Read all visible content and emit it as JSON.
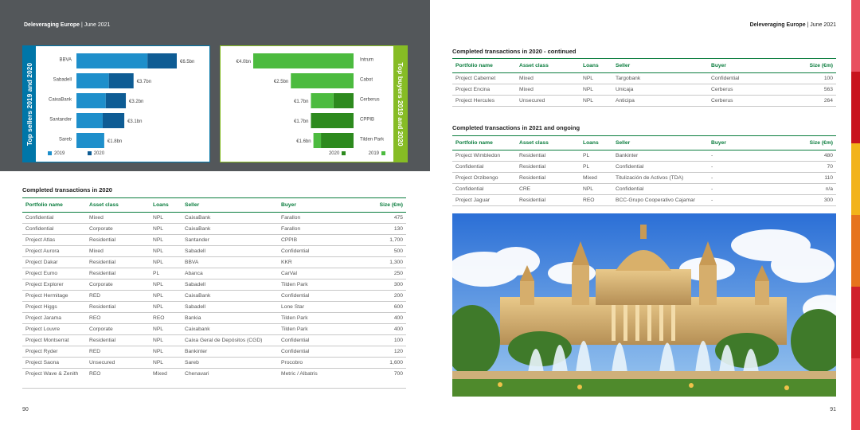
{
  "colors": {
    "blue_dark": "#0e5c94",
    "blue_light": "#1e8fcb",
    "green_dark": "#2d8a1e",
    "green_light": "#4cbb3f",
    "table_accent": "#0b7d3e"
  },
  "left_page": {
    "header_bold": "Deleveraging Europe",
    "header_rest": " | June 2021",
    "page_number": "90",
    "sellers_chart": {
      "side_title": "Top sellers 2019 and 2020",
      "legend": [
        "2019",
        "2020"
      ]
    },
    "buyers_chart": {
      "side_title": "Top buyers 2019 and 2020",
      "legend": [
        "2020",
        "2019"
      ]
    },
    "table_title": "Completed transactions in 2020",
    "table": {
      "headers": [
        "Portfolio name",
        "Asset class",
        "Loans",
        "Seller",
        "Buyer",
        "Size (€m)"
      ],
      "rows": [
        [
          "Confidential",
          "Mixed",
          "NPL",
          "CaixaBank",
          "Farallon",
          "475"
        ],
        [
          "Confidential",
          "Corporate",
          "NPL",
          "CaixaBank",
          "Farallon",
          "130"
        ],
        [
          "Project Atlas",
          "Residential",
          "NPL",
          "Santander",
          "CPPIB",
          "1,700"
        ],
        [
          "Project Aurora",
          "Mixed",
          "NPL",
          "Sabadell",
          "Confidential",
          "500"
        ],
        [
          "Project Dakar",
          "Residential",
          "NPL",
          "BBVA",
          "KKR",
          "1,300"
        ],
        [
          "Project Eumo",
          "Residential",
          "PL",
          "Abanca",
          "CarVal",
          "250"
        ],
        [
          "Project Explorer",
          "Corporate",
          "NPL",
          "Sabadell",
          "Tilden Park",
          "300"
        ],
        [
          "Project Hermitage",
          "RED",
          "NPL",
          "CaixaBank",
          "Confidential",
          "200"
        ],
        [
          "Project Higgs",
          "Residential",
          "NPL",
          "Sabadell",
          "Lone Star",
          "600"
        ],
        [
          "Project Jarama",
          "REO",
          "REO",
          "Bankia",
          "Tilden Park",
          "400"
        ],
        [
          "Project Louvre",
          "Corporate",
          "NPL",
          "Caixabank",
          "Tilden Park",
          "400"
        ],
        [
          "Project Montserrat",
          "Residential",
          "NPL",
          "Caixa Geral de Depósitos (CGD)",
          "Confidential",
          "100"
        ],
        [
          "Project Ryder",
          "RED",
          "NPL",
          "Bankinter",
          "Confidential",
          "120"
        ],
        [
          "Project Saona",
          "Unsecured",
          "NPL",
          "Sareb",
          "Procobro",
          "1,600"
        ],
        [
          "Project Wave & Zenith",
          "REO",
          "Mixed",
          "Chenavari",
          "Metric / Albatris",
          "700"
        ]
      ]
    }
  },
  "right_page": {
    "header_bold": "Deleveraging Europe",
    "header_rest": " | June 2021",
    "page_number": "91",
    "table1_title": "Completed transactions in 2020 - continued",
    "table1": {
      "headers": [
        "Portfolio name",
        "Asset class",
        "Loans",
        "Seller",
        "Buyer",
        "Size (€m)"
      ],
      "rows": [
        [
          "Project Cabernet",
          "Mixed",
          "NPL",
          "Targobank",
          "Confidential",
          "100"
        ],
        [
          "Project Encina",
          "Mixed",
          "NPL",
          "Unicaja",
          "Cerberus",
          "563"
        ],
        [
          "Project Hercules",
          "Unsecured",
          "NPL",
          "Anticipa",
          "Cerberus",
          "264"
        ]
      ]
    },
    "table2_title": "Completed transactions in 2021 and ongoing",
    "table2": {
      "headers": [
        "Portfolio name",
        "Asset class",
        "Loans",
        "Seller",
        "Buyer",
        "Size (€m)"
      ],
      "rows": [
        [
          "Project Wimbledon",
          "Residential",
          "PL",
          "Bankinter",
          "-",
          "480"
        ],
        [
          "Confidential",
          "Residential",
          "PL",
          "Confidential",
          "-",
          "70"
        ],
        [
          "Project Orzibengo",
          "Residential",
          "Mixed",
          "Titulización de Activos (TDA)",
          "-",
          "110"
        ],
        [
          "Confidential",
          "CRE",
          "NPL",
          "Confidential",
          "-",
          "n/a"
        ],
        [
          "Project Jaguar",
          "Residential",
          "REO",
          "BCC-Grupo Cooperativo Cajamar",
          "-",
          "300"
        ]
      ]
    },
    "photo_icon": "palace-fountain-photo"
  },
  "chart_data": [
    {
      "type": "bar",
      "orientation": "horizontal",
      "stacked": true,
      "title": "Top sellers 2019 and 2020",
      "categories": [
        "BBVA",
        "Sabadell",
        "CaixaBank",
        "Santander",
        "Sareb"
      ],
      "totals_labels": [
        "€6.5bn",
        "€3.7bn",
        "€3.2bn",
        "€3.1bn",
        "€1.8bn"
      ],
      "series": [
        {
          "name": "2019",
          "values": [
            4.6,
            2.1,
            1.9,
            1.7,
            1.8
          ]
        },
        {
          "name": "2020",
          "values": [
            1.9,
            1.6,
            1.3,
            1.4,
            0.0
          ]
        }
      ],
      "xlim": [
        0,
        6.5
      ],
      "legend_position": "bottom-left"
    },
    {
      "type": "bar",
      "orientation": "horizontal",
      "stacked": true,
      "title": "Top buyers 2019 and 2020",
      "categories": [
        "Intrum",
        "Cabot",
        "Cerberus",
        "CPPIB",
        "Tilden Park"
      ],
      "totals_labels": [
        "€4.0bn",
        "€2.5bn",
        "€1.7bn",
        "€1.7bn",
        "€1.6bn"
      ],
      "series": [
        {
          "name": "2020",
          "values": [
            0.0,
            0.0,
            0.8,
            1.7,
            1.3
          ]
        },
        {
          "name": "2019",
          "values": [
            4.0,
            2.5,
            0.9,
            0.0,
            0.3
          ]
        }
      ],
      "xlim": [
        0,
        4.0
      ],
      "legend_position": "bottom-right"
    }
  ]
}
